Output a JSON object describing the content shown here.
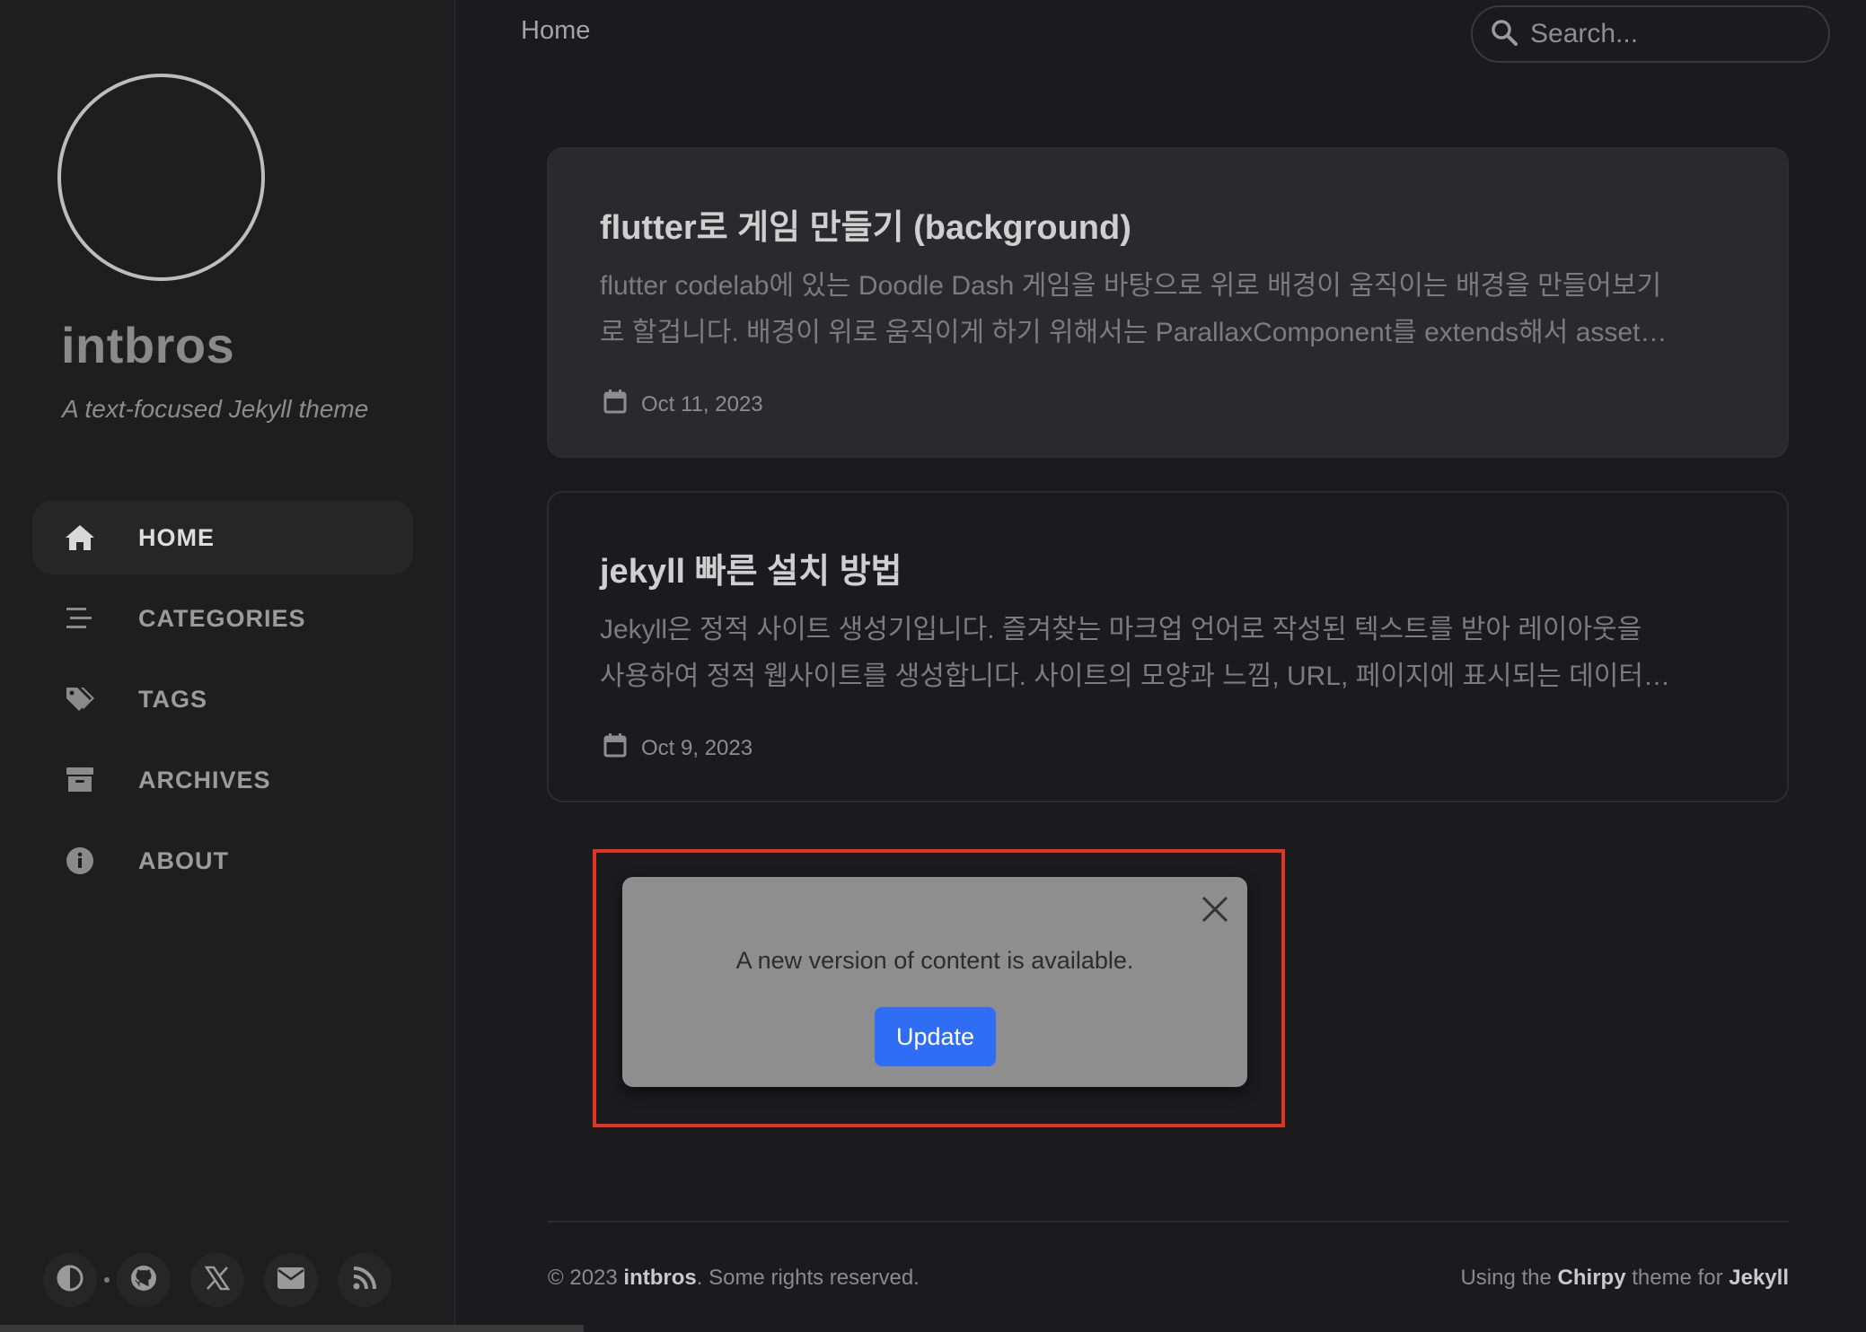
{
  "sidebar": {
    "title": "intbros",
    "subtitle": "A text-focused Jekyll theme",
    "nav": [
      {
        "label": "HOME",
        "icon": "home-icon",
        "active": true
      },
      {
        "label": "CATEGORIES",
        "icon": "stream-icon",
        "active": false
      },
      {
        "label": "TAGS",
        "icon": "tags-icon",
        "active": false
      },
      {
        "label": "ARCHIVES",
        "icon": "archive-icon",
        "active": false
      },
      {
        "label": "ABOUT",
        "icon": "info-circle-icon",
        "active": false
      }
    ],
    "bottom_icons": [
      "theme-toggle-icon",
      "github-icon",
      "x-twitter-icon",
      "email-icon",
      "rss-icon"
    ]
  },
  "topbar": {
    "breadcrumb": "Home",
    "search_placeholder": "Search..."
  },
  "posts": [
    {
      "title": "flutter로 게임 만들기 (background)",
      "excerpt_line1": "flutter codelab에 있는 Doodle Dash 게임을 바탕으로 위로 배경이 움직이는 배경을 만들어보기",
      "excerpt_line2": "로 할겁니다. 배경이 위로 움직이게 하기 위해서는 ParallaxComponent를 extends해서 asset…",
      "date": "Oct 11, 2023"
    },
    {
      "title": "jekyll 빠른 설치 방법",
      "excerpt_line1": "Jekyll은 정적 사이트 생성기입니다. 즐겨찾는 마크업 언어로 작성된 텍스트를 받아 레이아웃을",
      "excerpt_line2": "사용하여 정적 웹사이트를 생성합니다. 사이트의 모양과 느낌, URL, 페이지에 표시되는 데이터…",
      "date": "Oct 9, 2023"
    }
  ],
  "toast": {
    "message": "A new version of content is available.",
    "button": "Update"
  },
  "footer": {
    "copyright_prefix": "© 2023 ",
    "owner": "intbros",
    "copyright_suffix": ". Some rights reserved.",
    "using_prefix": "Using the ",
    "theme": "Chirpy",
    "theme_mid": " theme for ",
    "engine": "Jekyll"
  },
  "colors": {
    "background": "#1b1b1e",
    "accent_button": "#2f6ef4",
    "highlight_border": "#e0341f"
  }
}
